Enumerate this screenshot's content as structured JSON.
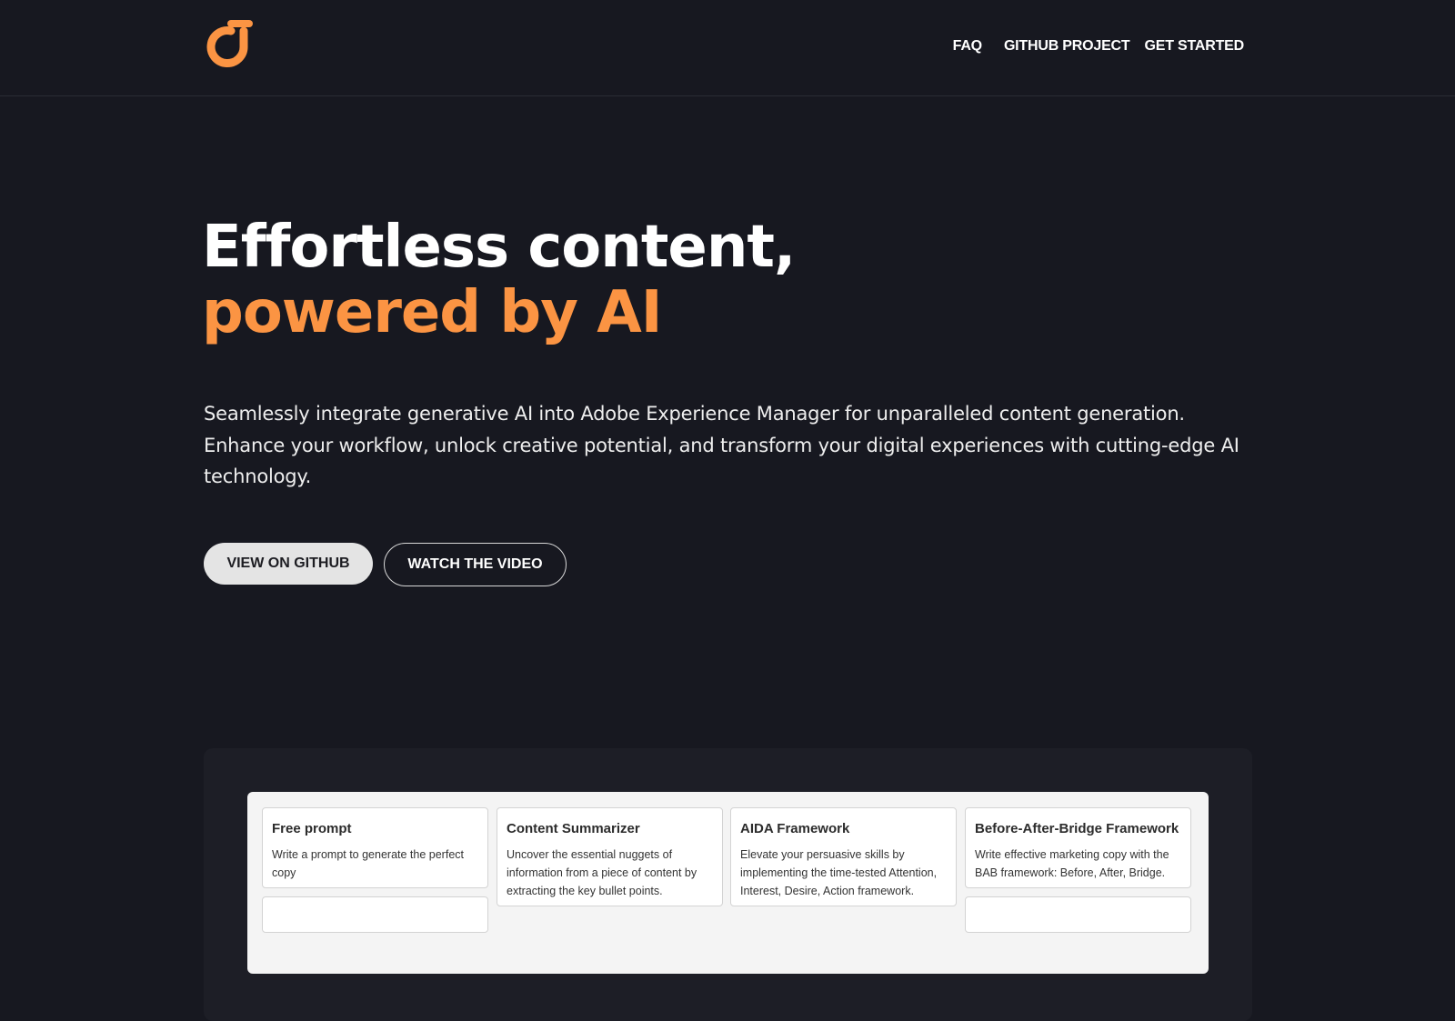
{
  "header": {
    "logo_icon": "brand-logo-icon",
    "nav": {
      "faq": "FAQ",
      "github_project": "GITHUB PROJECT",
      "get_started": "GET STARTED"
    }
  },
  "hero": {
    "title_line1": "Effortless content,",
    "title_line2": "powered by AI",
    "description": "Seamlessly integrate generative AI into Adobe Experience Manager for unparalleled content generation. Enhance your workflow, unlock creative potential, and transform your digital experiences with cutting-edge AI technology.",
    "buttons": {
      "github": "VIEW ON GITHUB",
      "video": "WATCH THE VIDEO"
    }
  },
  "showcase": {
    "cards": [
      {
        "title": "Free prompt",
        "desc": "Write a prompt to generate the perfect copy"
      },
      {
        "title": "Content Summarizer",
        "desc": "Uncover the essential nuggets of information from a piece of content by extracting the key bullet points."
      },
      {
        "title": "AIDA Framework",
        "desc": "Elevate your persuasive skills by implementing the time-tested Attention, Interest, Desire, Action framework."
      },
      {
        "title": "Before-After-Bridge Framework",
        "desc": "Write effective marketing copy with the BAB framework: Before, After, Bridge."
      }
    ]
  },
  "colors": {
    "background": "#171820",
    "accent": "#fb9443",
    "text": "#ffffff"
  }
}
